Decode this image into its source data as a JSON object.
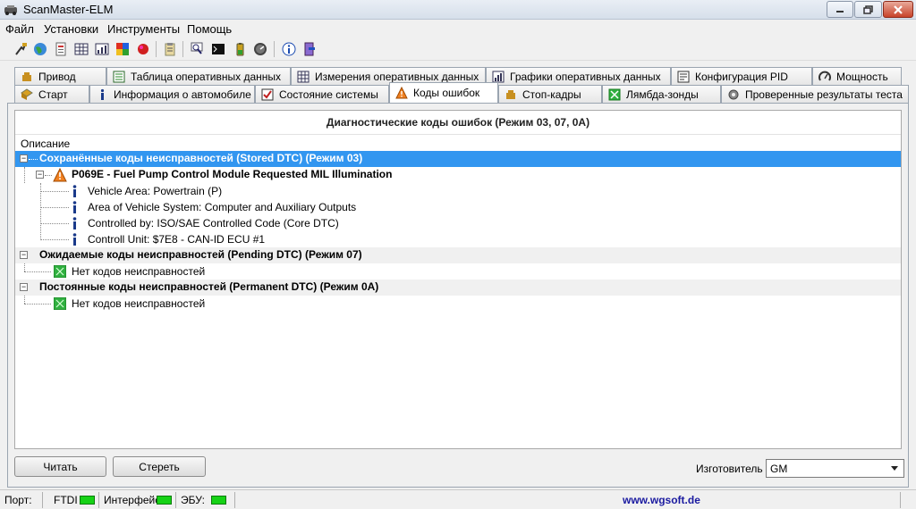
{
  "window": {
    "title": "ScanMaster-ELM",
    "app_icon": "car-scanner-icon",
    "controls": [
      "minimize-icon",
      "maximize-icon",
      "close-icon"
    ]
  },
  "menu": [
    "Файл",
    "Установки",
    "Инструменты",
    "Помощь"
  ],
  "toolbar_icons": [
    "connect-icon",
    "globe-icon",
    "report-icon",
    "grid-icon",
    "chart-icon",
    "colors-icon",
    "ball-icon",
    "clipboard-icon",
    "search-icon",
    "terminal-icon",
    "battery-icon",
    "gauge-icon",
    "info-icon",
    "exit-icon"
  ],
  "tabs_row1": [
    {
      "label": "Привод",
      "icon": "engine-icon"
    },
    {
      "label": "Таблица оперативных данных",
      "icon": "table-icon"
    },
    {
      "label": "Измерения оперативных данных",
      "icon": "grid-icon"
    },
    {
      "label": "Графики оперативных данных",
      "icon": "chart-icon"
    },
    {
      "label": "Конфигурация PID",
      "icon": "config-icon"
    },
    {
      "label": "Мощность",
      "icon": "power-icon"
    }
  ],
  "tabs_row2": [
    {
      "label": "Старт",
      "icon": "start-icon"
    },
    {
      "label": "Информация о автомобиле",
      "icon": "info-icon"
    },
    {
      "label": "Состояние системы",
      "icon": "checkbox-icon"
    },
    {
      "label": "Коды ошибок",
      "icon": "warning-icon"
    },
    {
      "label": "Стоп-кадры",
      "icon": "freeze-frame-icon"
    },
    {
      "label": "Лямбда-зонды",
      "icon": "oxygen-sensor-icon"
    },
    {
      "label": "Проверенные результаты теста",
      "icon": "gear-icon"
    }
  ],
  "active_tab": "Коды ошибок",
  "dtc": {
    "header": "Диагностические коды ошибок (Режим 03, 07, 0A)",
    "column": "Описание",
    "stored": {
      "label": "Сохранённые коды неисправностей (Stored DTC) (Режим 03)",
      "code": "P069E - Fuel Pump Control Module Requested MIL Illumination",
      "details": [
        "Vehicle Area: Powertrain (P)",
        "Area of Vehicle System: Computer and Auxiliary Outputs",
        "Controlled by: ISO/SAE Controlled Code (Core DTC)",
        "Controll Unit: $7E8 - CAN-ID ECU #1"
      ]
    },
    "pending": {
      "label": "Ожидаемые коды неисправностей (Pending DTC) (Режим 07)",
      "none": "Нет кодов неисправностей"
    },
    "permanent": {
      "label": "Постоянные коды неисправностей (Permanent DTC) (Режим 0A)",
      "none": "Нет кодов неисправностей"
    }
  },
  "buttons": {
    "read": "Читать",
    "clear": "Стереть"
  },
  "manufacturer": {
    "label": "Изготовитель",
    "value": "GM"
  },
  "status": {
    "port": "Порт:",
    "ftdi": "FTDI",
    "interface": "Интерфейс:",
    "ecu": "ЭБУ:",
    "website": "www.wgsoft.de"
  },
  "colors": {
    "selection": "#3296f0",
    "led": "#16d216",
    "link": "#1a1aa0",
    "warning": "#f08020"
  }
}
